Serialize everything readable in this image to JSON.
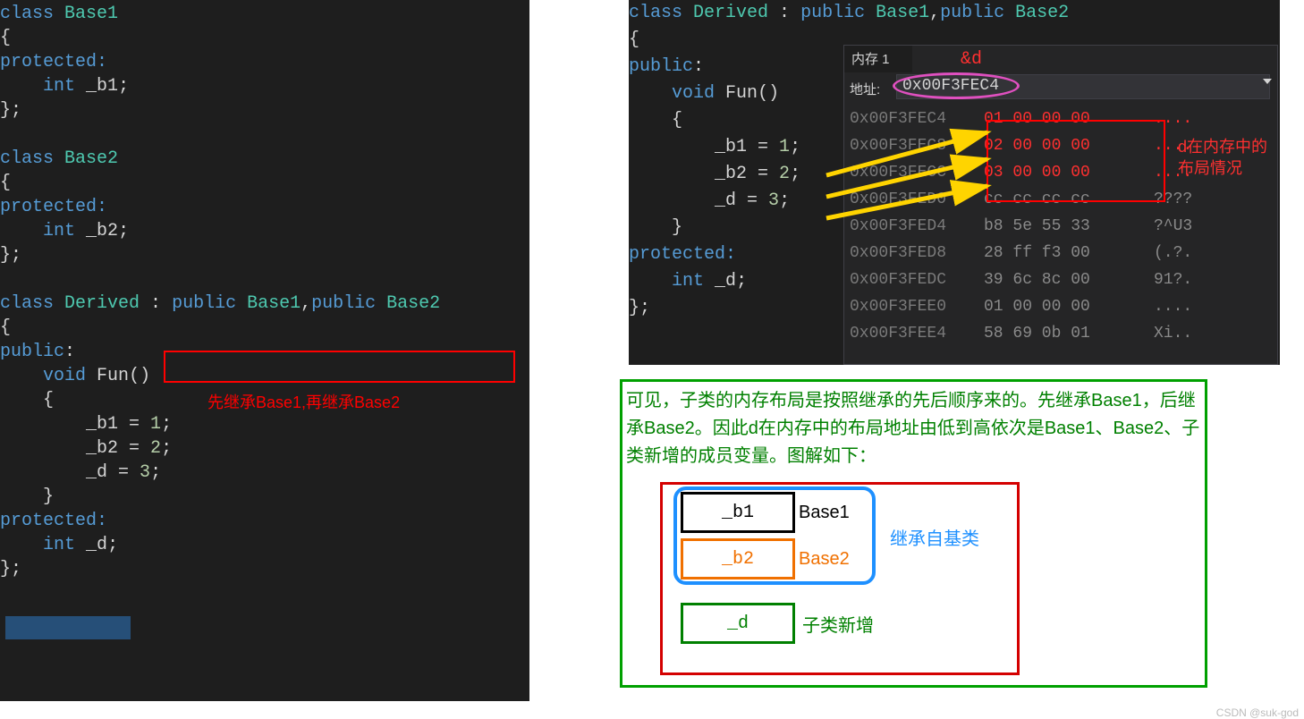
{
  "left_code": {
    "base1": {
      "decl": "class Base1",
      "prot": "protected:",
      "mem_kw": "int",
      "mem_name": "_b1"
    },
    "base2": {
      "decl": "class Base2",
      "prot": "protected:",
      "mem_kw": "int",
      "mem_name": "_b2"
    },
    "derived": {
      "decl_part1": "class Derived : ",
      "decl_part2": "public Base1,public Base2",
      "pub": "public:",
      "fun_sig_kw": "void",
      "fun_sig_name": "Fun",
      "assign1_l": "_b1",
      "assign1_r": "1",
      "assign2_l": "_b2",
      "assign2_r": "2",
      "assign3_l": "_d",
      "assign3_r": "3",
      "prot": "protected:",
      "mem_kw": "int",
      "mem_name": "_d"
    },
    "annotation": "先继承Base1,再继承Base2"
  },
  "right_code": {
    "derived_decl_part1": "class Derived : ",
    "derived_decl_part2": "public Base1,public Base2",
    "pub": "public:",
    "fun_sig_kw": "void",
    "fun_sig_name": "Fun",
    "assign1_l": "_b1",
    "assign1_r": "1",
    "assign2_l": "_b2",
    "assign2_r": "2",
    "assign3_l": "_d",
    "assign3_r": "3",
    "prot": "protected:",
    "mem_kw": "int",
    "mem_name": "_d"
  },
  "memory": {
    "tab": "内存 1",
    "amp": "&d",
    "addr_label": "地址:",
    "addr_value": "0x00F3FEC4",
    "rows": [
      {
        "addr": "0x00F3FEC4",
        "bytes": "01 00 00 00",
        "ascii": "....",
        "hl": true
      },
      {
        "addr": "0x00F3FEC8",
        "bytes": "02 00 00 00",
        "ascii": "....",
        "hl": true
      },
      {
        "addr": "0x00F3FECC",
        "bytes": "03 00 00 00",
        "ascii": "....",
        "hl": true
      },
      {
        "addr": "0x00F3FED0",
        "bytes": "cc cc cc cc",
        "ascii": "????",
        "hl": false
      },
      {
        "addr": "0x00F3FED4",
        "bytes": "b8 5e 55 33",
        "ascii": "?^U3",
        "hl": false
      },
      {
        "addr": "0x00F3FED8",
        "bytes": "28 ff f3 00",
        "ascii": "(.?.",
        "hl": false
      },
      {
        "addr": "0x00F3FEDC",
        "bytes": "39 6c 8c 00",
        "ascii": "91?.",
        "hl": false
      },
      {
        "addr": "0x00F3FEE0",
        "bytes": "01 00 00 00",
        "ascii": "....",
        "hl": false
      },
      {
        "addr": "0x00F3FEE4",
        "bytes": "58 69 0b 01",
        "ascii": "Xi..",
        "hl": false
      }
    ],
    "anno_line1": "d在内存中的",
    "anno_line2": "布局情况"
  },
  "explain": {
    "text": "可见，子类的内存布局是按照继承的先后顺序来的。先继承Base1，后继承Base2。因此d在内存中的布局地址由低到高依次是Base1、Base2、子类新增的成员变量。图解如下：",
    "cells": {
      "b1": "_b1",
      "base1": "Base1",
      "b2": "_b2",
      "base2": "Base2",
      "d": "_d",
      "dlbl": "子类新增"
    },
    "blue_label": "继承自基类"
  },
  "watermark": "CSDN @suk-god"
}
